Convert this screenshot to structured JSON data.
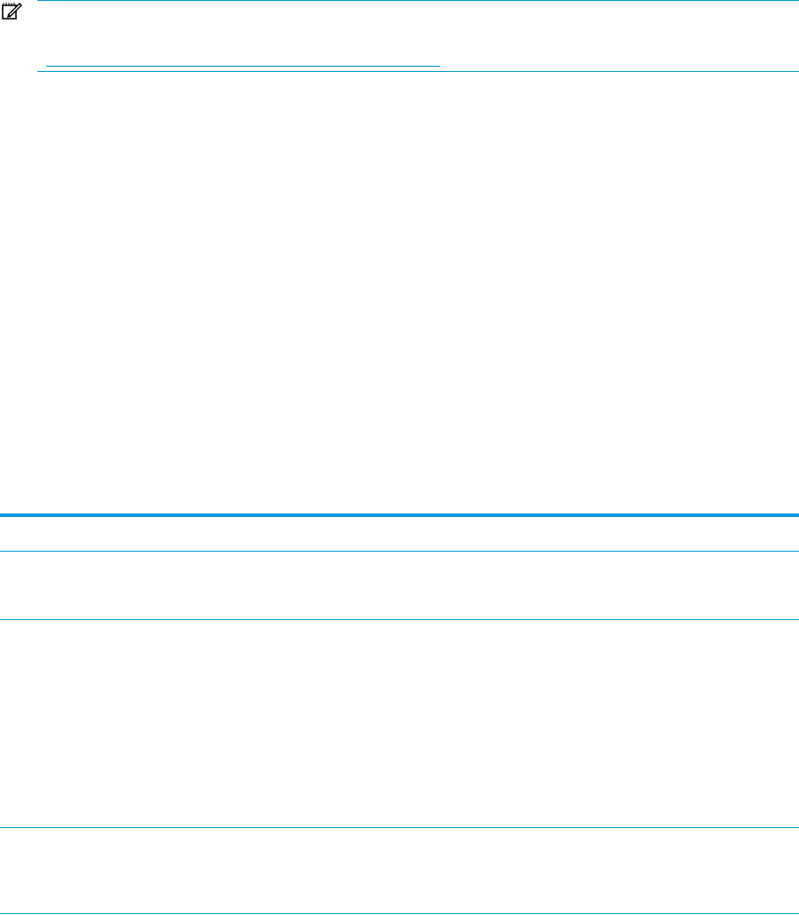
{
  "note": {
    "icon": "note-pencil-icon",
    "accent_color": "#0096d6"
  },
  "table": {
    "rule_color": "#0096d6",
    "row_count": 4
  }
}
